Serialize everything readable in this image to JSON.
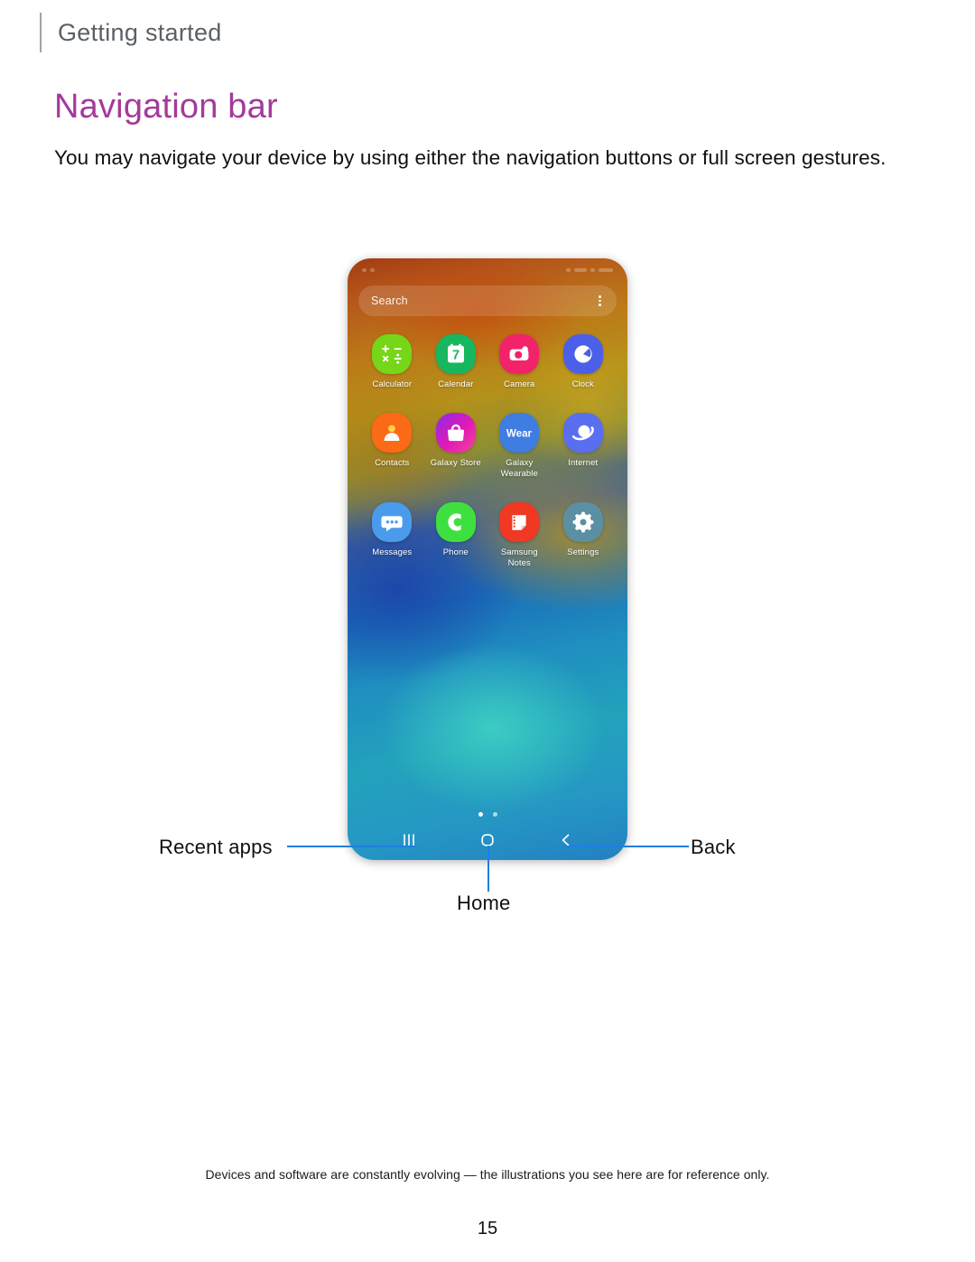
{
  "header": {
    "breadcrumb": "Getting started"
  },
  "section": {
    "title": "Navigation bar",
    "intro": "You may navigate your device by using either the navigation buttons or full screen gestures."
  },
  "phone": {
    "search": {
      "placeholder": "Search",
      "menu_icon": "kebab-menu-icon"
    },
    "apps": [
      {
        "label": "Calculator",
        "icon": "calculator-icon",
        "bg": "#76d618"
      },
      {
        "label": "Calendar",
        "icon": "calendar-icon",
        "bg": "#16b75e",
        "day": "7"
      },
      {
        "label": "Camera",
        "icon": "camera-icon",
        "bg": "#f2236b"
      },
      {
        "label": "Clock",
        "icon": "clock-icon",
        "bg": "#4c5fe8"
      },
      {
        "label": "Contacts",
        "icon": "contacts-icon",
        "bg": "#fb6a16"
      },
      {
        "label": "Galaxy Store",
        "icon": "galaxy-store-icon",
        "bg": "#e21ab4"
      },
      {
        "label": "Galaxy\nWearable",
        "icon": "galaxy-wearable-icon",
        "bg": "#3f7de2",
        "wordmark": "Wear"
      },
      {
        "label": "Internet",
        "icon": "internet-icon",
        "bg": "#5a6ef0"
      },
      {
        "label": "Messages",
        "icon": "messages-icon",
        "bg": "#4a9bec"
      },
      {
        "label": "Phone",
        "icon": "phone-icon",
        "bg": "#3ee040"
      },
      {
        "label": "Samsung\nNotes",
        "icon": "samsung-notes-icon",
        "bg": "#f03822"
      },
      {
        "label": "Settings",
        "icon": "settings-gear-icon",
        "bg": "#5b8fa3"
      }
    ],
    "page_indicator": {
      "count": 2,
      "active": 1
    },
    "navbar": [
      {
        "name": "recent-apps",
        "icon": "recent-apps-icon"
      },
      {
        "name": "home",
        "icon": "home-circle-icon"
      },
      {
        "name": "back",
        "icon": "back-chevron-icon"
      }
    ]
  },
  "callouts": {
    "recent_apps": "Recent apps",
    "home": "Home",
    "back": "Back",
    "leader_color": "#1f7fe0"
  },
  "footer": {
    "note": "Devices and software are constantly evolving — the illustrations you see here are for reference only.",
    "page_number": "15"
  },
  "colors": {
    "title": "#a33b9a",
    "breadcrumb": "#5a6066",
    "body": "#101010"
  }
}
